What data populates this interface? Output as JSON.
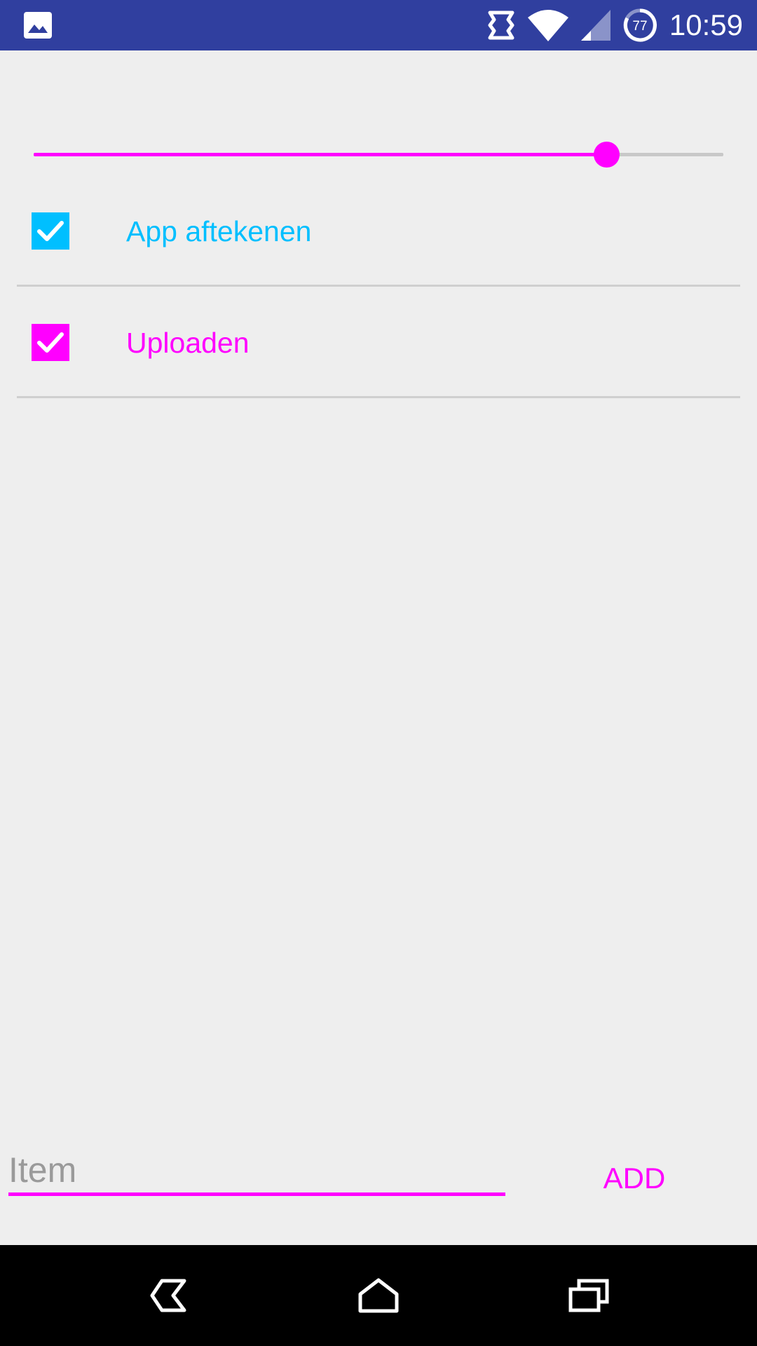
{
  "status_bar": {
    "time": "10:59",
    "battery_level": "77",
    "background_color": "#303f9f",
    "icons": [
      "gallery-icon",
      "nfc-icon",
      "wifi-icon",
      "cell-signal-icon",
      "battery-icon"
    ]
  },
  "slider": {
    "value_fraction": 0.83,
    "accent_color": "#ff00ff"
  },
  "list": {
    "items": [
      {
        "label": "App aftekenen",
        "checked": true,
        "color": "#00bfff"
      },
      {
        "label": "Uploaden",
        "checked": true,
        "color": "#ff00ff"
      }
    ]
  },
  "input": {
    "placeholder": "Item",
    "value": ""
  },
  "add_button": {
    "label": "ADD",
    "color": "#ff00ff"
  },
  "nav_bar": {
    "icons": [
      "back-icon",
      "home-icon",
      "recents-icon"
    ]
  }
}
